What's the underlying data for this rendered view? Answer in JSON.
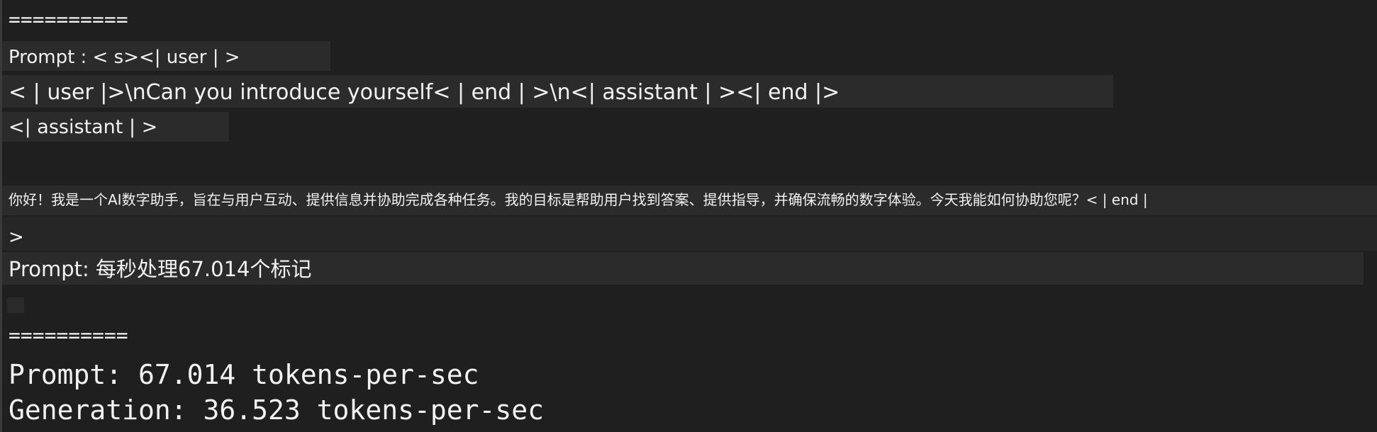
{
  "terminal": {
    "separator_top": "==========",
    "prompt_line_1": "Prompt : < s><| user | >",
    "prompt_line_2": "< | user |>\\nCan you introduce yourself< | end | >\\n<| assistant | ><| end |>",
    "prompt_line_3": "<| assistant | >",
    "response_line": "你好！我是一个AI数字助手，旨在与用户互动、提供信息并协助完成各种任务。我的目标是帮助用户找到答案、提供指导，并确保流畅的数字体验。今天我能如何协助您呢？< | end |",
    "response_continuation": ">",
    "translated_stats": "Prompt: 每秒处理67.014个标记",
    "separator_bottom": "==========",
    "stat_prompt": "Prompt: 67.014 tokens-per-sec",
    "stat_generation": "Generation: 36.523 tokens-per-sec"
  },
  "colors": {
    "background": "#1f1f1f",
    "text": "#f2f2f2",
    "highlight": "#2b2b2b"
  }
}
